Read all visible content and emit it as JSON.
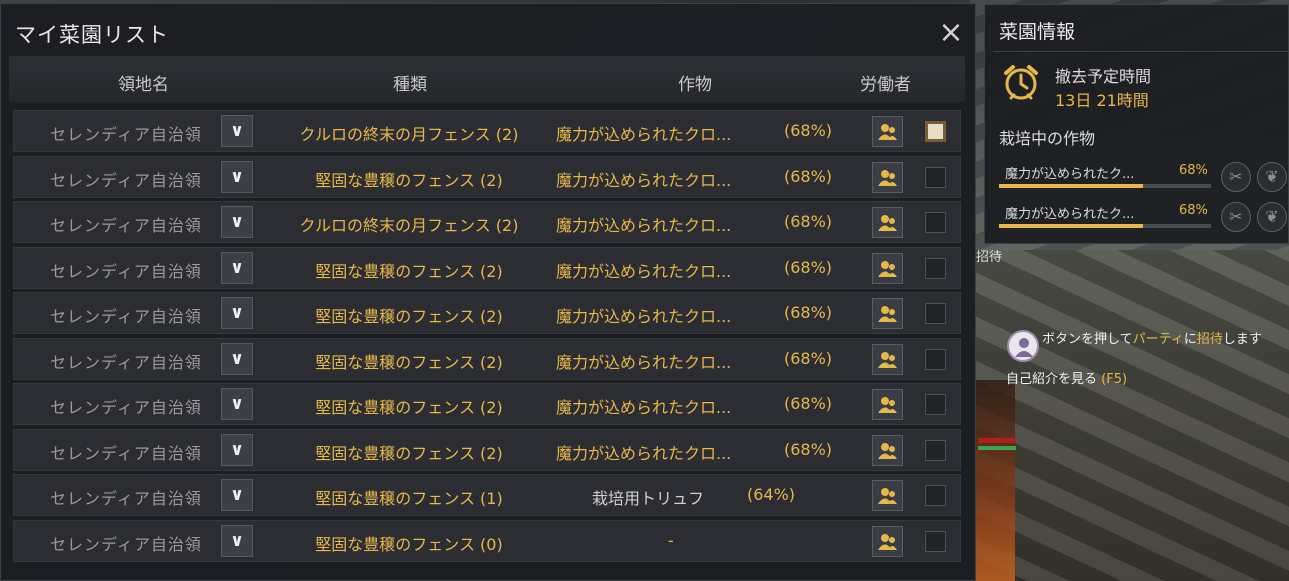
{
  "window": {
    "title": "マイ菜園リスト",
    "close_icon": "×"
  },
  "headers": {
    "region": "領地名",
    "kind": "種類",
    "crop": "作物",
    "worker": "労働者"
  },
  "rows": [
    {
      "region": "セレンディア自治領",
      "kind": "クルロの終末の月フェンス (2)",
      "crop": "魔力が込められたクロ...",
      "pct": "(68%)",
      "checked": true
    },
    {
      "region": "セレンディア自治領",
      "kind": "堅固な豊穣のフェンス (2)",
      "crop": "魔力が込められたクロ...",
      "pct": "(68%)",
      "checked": false
    },
    {
      "region": "セレンディア自治領",
      "kind": "クルロの終末の月フェンス (2)",
      "crop": "魔力が込められたクロ...",
      "pct": "(68%)",
      "checked": false
    },
    {
      "region": "セレンディア自治領",
      "kind": "堅固な豊穣のフェンス (2)",
      "crop": "魔力が込められたクロ...",
      "pct": "(68%)",
      "checked": false
    },
    {
      "region": "セレンディア自治領",
      "kind": "堅固な豊穣のフェンス (2)",
      "crop": "魔力が込められたクロ...",
      "pct": "(68%)",
      "checked": false
    },
    {
      "region": "セレンディア自治領",
      "kind": "堅固な豊穣のフェンス (2)",
      "crop": "魔力が込められたクロ...",
      "pct": "(68%)",
      "checked": false
    },
    {
      "region": "セレンディア自治領",
      "kind": "堅固な豊穣のフェンス (2)",
      "crop": "魔力が込められたクロ...",
      "pct": "(68%)",
      "checked": false
    },
    {
      "region": "セレンディア自治領",
      "kind": "堅固な豊穣のフェンス (2)",
      "crop": "魔力が込められたクロ...",
      "pct": "(68%)",
      "checked": false
    },
    {
      "region": "セレンディア自治領",
      "kind": "堅固な豊穣のフェンス (1)",
      "crop": "栽培用トリュフ",
      "pct": "(64%)",
      "checked": false
    },
    {
      "region": "セレンディア自治領",
      "kind": "堅固な豊穣のフェンス (0)",
      "crop": "-",
      "pct": "",
      "checked": false
    }
  ],
  "dropdown_icon": "chevron-down-icon",
  "worker_icon": "workers-icon",
  "info": {
    "title": "菜園情報",
    "removal_label": "撤去予定時間",
    "removal_time": "13日 21時間",
    "growing_label": "栽培中の作物",
    "crops": [
      {
        "name": "魔力が込められたク...",
        "pct": "68%",
        "progress": 0.68
      },
      {
        "name": "魔力が込められたク...",
        "pct": "68%",
        "progress": 0.68
      }
    ]
  },
  "party": {
    "invite": "招待",
    "msg_prefix": "ボタンを押して",
    "msg_party": "パーティ",
    "msg_mid": "に",
    "msg_invite": "招待",
    "msg_suffix": "します",
    "profile": "自己紹介を見る",
    "profile_key": "(F5)"
  },
  "colors": {
    "accent_gold": "#e6b84a",
    "panel_bg": "#1b1d21",
    "row_bg": "#2b2d32"
  }
}
